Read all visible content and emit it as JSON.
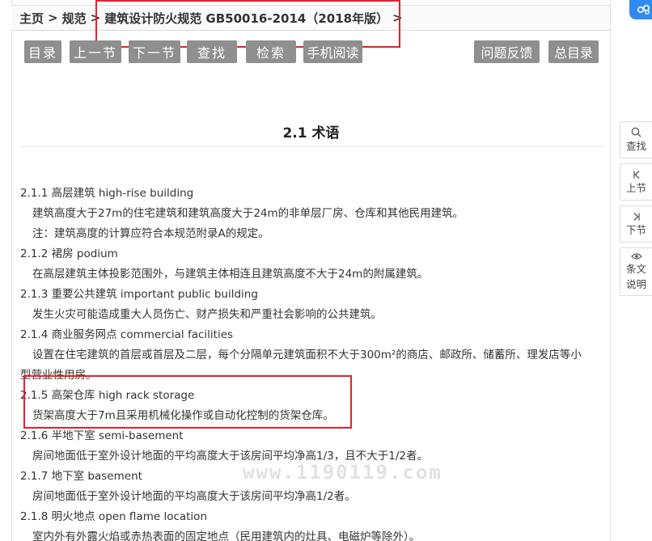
{
  "breadcrumb": {
    "home": "主页",
    "sep": ">",
    "standards": "规范",
    "current": "建筑设计防火规范 GB50016-2014（2018年版）"
  },
  "toolbar": {
    "contents": "目录",
    "prev": "上一节",
    "next": "下一节",
    "find": "查找",
    "search": "检索",
    "mobile": "手机阅读",
    "feedback": "问题反馈",
    "all_contents": "总目录"
  },
  "section": {
    "title": "2.1 术语"
  },
  "terms": [
    {
      "heading": "2.1.1 高层建筑 high-rise building",
      "lines": [
        "建筑高度大于27m的住宅建筑和建筑高度大于24m的非单层厂房、仓库和其他民用建筑。",
        "注：建筑高度的计算应符合本规范附录A的规定。"
      ]
    },
    {
      "heading": "2.1.2 裙房 podium",
      "lines": [
        "在高层建筑主体投影范围外，与建筑主体相连且建筑高度不大于24m的附属建筑。"
      ]
    },
    {
      "heading": "2.1.3 重要公共建筑 important public building",
      "lines": [
        "发生火灾可能造成重大人员伤亡、财产损失和严重社会影响的公共建筑。"
      ]
    },
    {
      "heading": "2.1.4 商业服务网点 commercial facilities",
      "lines": [
        "设置在住宅建筑的首层或首层及二层，每个分隔单元建筑面积不大于300m²的商店、邮政所、储蓄所、理发店等小",
        "型营业性用房。"
      ]
    },
    {
      "heading": "2.1.5 高架仓库 high rack storage",
      "lines": [
        "货架高度大于7m且采用机械化操作或自动化控制的货架仓库。"
      ]
    },
    {
      "heading": "2.1.6 半地下室 semi-basement",
      "lines": [
        "房间地面低于室外设计地面的平均高度大于该房间平均净高1/3，且不大于1/2者。"
      ]
    },
    {
      "heading": "2.1.7 地下室 basement",
      "lines": [
        "房间地面低于室外设计地面的平均高度大于该房间平均净高1/2者。"
      ]
    },
    {
      "heading": "2.1.8 明火地点 open flame location",
      "lines": [
        "室内外有外露火焰或赤热表面的固定地点（民用建筑内的灶具、电磁炉等除外）。"
      ]
    }
  ],
  "sidebar": {
    "find": "查找",
    "prev": "上节",
    "next": "下节",
    "clause_note_1": "条文",
    "clause_note_2": "说明"
  },
  "watermark": "www.1190119.com",
  "colors": {
    "toolbar_button": "#8f8f8f",
    "highlight": "#e8202c",
    "badge": "#2f8bf0"
  }
}
